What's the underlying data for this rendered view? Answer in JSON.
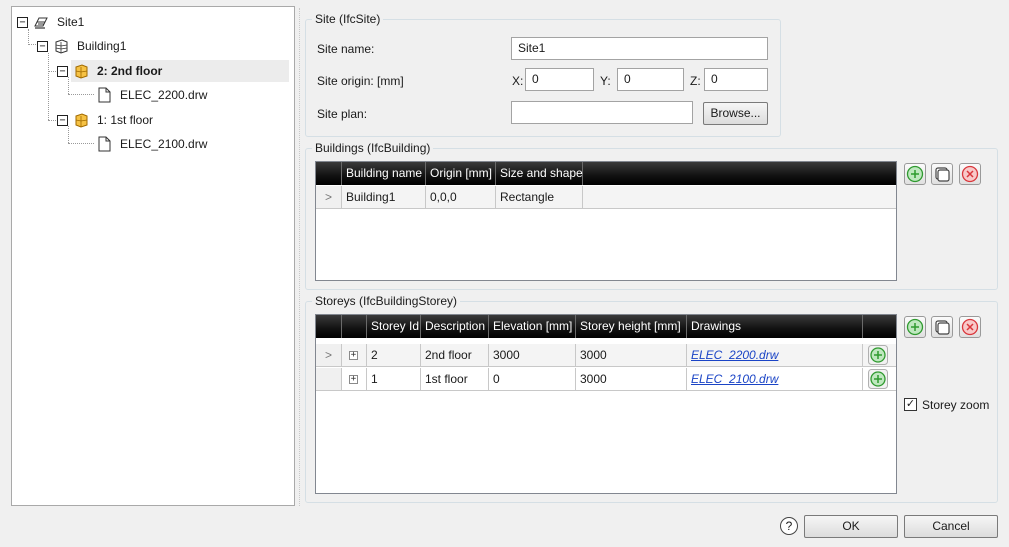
{
  "tree": {
    "nodes": [
      {
        "label": "Site1",
        "expander": "−",
        "icon": "site-icon"
      },
      {
        "label": "Building1",
        "expander": "−",
        "icon": "building-icon"
      },
      {
        "label": "2: 2nd floor",
        "expander": "−",
        "icon": "storey-icon",
        "selected": true
      },
      {
        "label": "ELEC_2200.drw",
        "icon": "document-icon"
      },
      {
        "label": "1: 1st floor",
        "expander": "−",
        "icon": "storey-icon"
      },
      {
        "label": "ELEC_2100.drw",
        "icon": "document-icon"
      }
    ]
  },
  "site": {
    "title": "Site (IfcSite)",
    "name_label": "Site name:",
    "name_value": "Site1",
    "origin_label": "Site origin: [mm]",
    "x_label": "X:",
    "x_value": "0",
    "y_label": "Y:",
    "y_value": "0",
    "z_label": "Z:",
    "z_value": "0",
    "plan_label": "Site plan:",
    "plan_value": "",
    "browse_label": "Browse..."
  },
  "buildings": {
    "title": "Buildings (IfcBuilding)",
    "columns": [
      "Building name",
      "Origin [mm]",
      "Size and shape"
    ],
    "rows": [
      {
        "marker": ">",
        "name": "Building1",
        "origin": "0,0,0",
        "shape": "Rectangle"
      }
    ]
  },
  "storeys": {
    "title": "Storeys (IfcBuildingStorey)",
    "columns": [
      "Storey Id",
      "Description",
      "Elevation [mm]",
      "Storey height [mm]",
      "Drawings"
    ],
    "rows": [
      {
        "marker": ">",
        "expander": "+",
        "id": "2",
        "description": "2nd floor",
        "elevation": "3000",
        "height": "3000",
        "drawing": "ELEC_2200.drw"
      },
      {
        "marker": "",
        "expander": "+",
        "id": "1",
        "description": "1st floor",
        "elevation": "0",
        "height": "3000",
        "drawing": "ELEC_2100.drw"
      }
    ],
    "zoom_label": "Storey zoom",
    "zoom_checked": "✓"
  },
  "footer": {
    "help": "?",
    "ok": "OK",
    "cancel": "Cancel"
  },
  "colors": {
    "add": "#2f9a2f",
    "delete": "#d9373c",
    "link": "#1a44c6",
    "header": "#111111"
  }
}
